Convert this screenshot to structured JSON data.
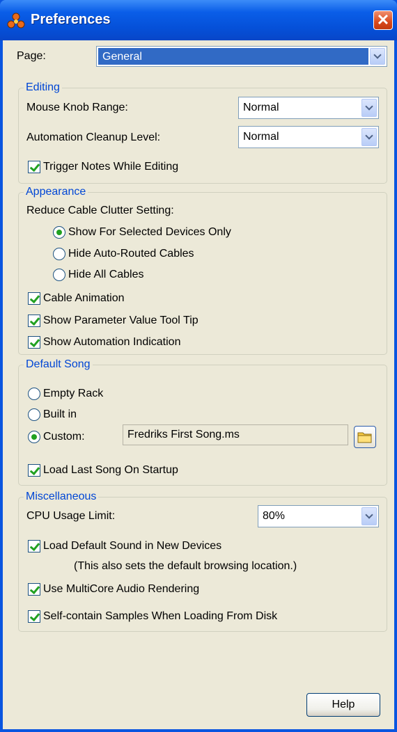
{
  "window": {
    "title": "Preferences",
    "close_label": "✕"
  },
  "page_selector": {
    "label": "Page:",
    "value": "General"
  },
  "editing": {
    "legend": "Editing",
    "mouse_knob_label": "Mouse Knob Range:",
    "mouse_knob_value": "Normal",
    "automation_cleanup_label": "Automation Cleanup Level:",
    "automation_cleanup_value": "Normal",
    "trigger_notes_label": "Trigger Notes While Editing",
    "trigger_notes_checked": true
  },
  "appearance": {
    "legend": "Appearance",
    "clutter_label": "Reduce Cable Clutter Setting:",
    "options": [
      {
        "label": "Show For Selected Devices Only",
        "selected": true
      },
      {
        "label": "Hide Auto-Routed Cables",
        "selected": false
      },
      {
        "label": "Hide All Cables",
        "selected": false
      }
    ],
    "cable_animation_label": "Cable Animation",
    "param_tooltip_label": "Show Parameter Value Tool Tip",
    "automation_indication_label": "Show Automation Indication"
  },
  "default_song": {
    "legend": "Default Song",
    "empty_rack_label": "Empty Rack",
    "built_in_label": "Built in",
    "custom_label": "Custom:",
    "custom_path": "Fredriks First Song.ms",
    "load_last_label": "Load Last Song On Startup"
  },
  "misc": {
    "legend": "Miscellaneous",
    "cpu_label": "CPU Usage Limit:",
    "cpu_value": "80%",
    "load_default_sound_label": "Load Default Sound in New Devices",
    "load_default_sound_note": "(This also sets the default browsing location.)",
    "multicore_label": "Use MultiCore Audio Rendering",
    "self_contain_label": "Self-contain Samples When Loading From Disk"
  },
  "buttons": {
    "help": "Help"
  },
  "colors": {
    "titlebar": "#0a5ee8",
    "dialog_bg": "#ece9d8",
    "legend_text": "#0046d5",
    "check_green": "#21a121",
    "selection": "#316ac5"
  }
}
